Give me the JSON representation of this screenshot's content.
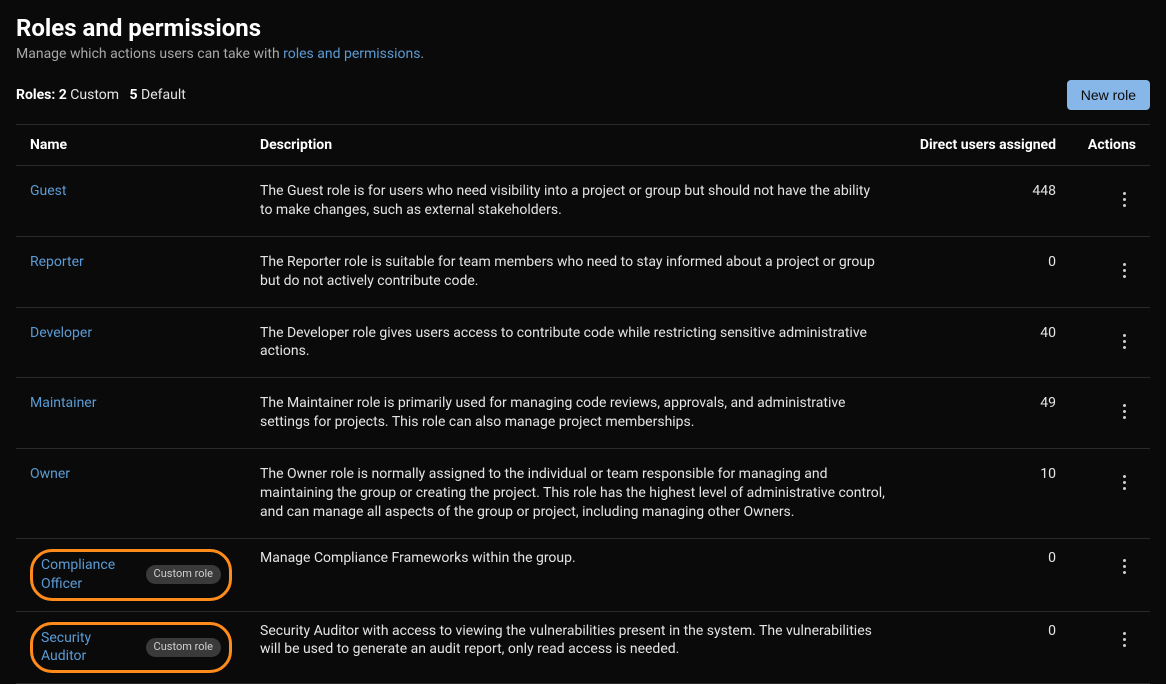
{
  "header": {
    "title": "Roles and permissions",
    "subtitle_prefix": "Manage which actions users can take with ",
    "subtitle_link": "roles and permissions",
    "subtitle_suffix": "."
  },
  "summary": {
    "roles_label": "Roles:",
    "custom_count": "2",
    "custom_label": "Custom",
    "default_count": "5",
    "default_label": "Default"
  },
  "new_role_button": "New role",
  "columns": {
    "name": "Name",
    "description": "Description",
    "users": "Direct users assigned",
    "actions": "Actions"
  },
  "badge_label": "Custom role",
  "roles": [
    {
      "name": "Guest",
      "description": "The Guest role is for users who need visibility into a project or group but should not have the ability to make changes, such as external stakeholders.",
      "users": "448",
      "custom": false
    },
    {
      "name": "Reporter",
      "description": "The Reporter role is suitable for team members who need to stay informed about a project or group but do not actively contribute code.",
      "users": "0",
      "custom": false
    },
    {
      "name": "Developer",
      "description": "The Developer role gives users access to contribute code while restricting sensitive administrative actions.",
      "users": "40",
      "custom": false
    },
    {
      "name": "Maintainer",
      "description": "The Maintainer role is primarily used for managing code reviews, approvals, and administrative settings for projects. This role can also manage project memberships.",
      "users": "49",
      "custom": false
    },
    {
      "name": "Owner",
      "description": "The Owner role is normally assigned to the individual or team responsible for managing and maintaining the group or creating the project. This role has the highest level of administrative control, and can manage all aspects of the group or project, including managing other Owners.",
      "users": "10",
      "custom": false
    },
    {
      "name": "Compliance Officer",
      "description": "Manage Compliance Frameworks within the group.",
      "users": "0",
      "custom": true
    },
    {
      "name": "Security Auditor",
      "description": "Security Auditor with access to viewing the vulnerabilities present in the system. The vulnerabilities will be used to generate an audit report, only read access is needed.",
      "users": "0",
      "custom": true
    }
  ]
}
